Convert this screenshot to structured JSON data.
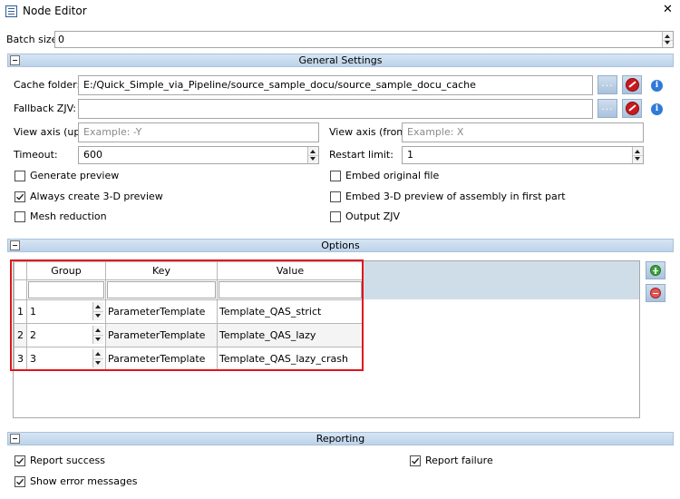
{
  "window": {
    "title": "Node Editor",
    "close_glyph": "✕"
  },
  "batch_size": {
    "label": "Batch size:",
    "value": "0"
  },
  "general": {
    "title": "General Settings",
    "cache_folder": {
      "label": "Cache folder:",
      "value": "E:/Quick_Simple_via_Pipeline/source_sample_docu/source_sample_docu_cache",
      "browse_label": "..."
    },
    "fallback_zjv": {
      "label": "Fallback ZJV:",
      "value": "",
      "browse_label": "..."
    },
    "view_axis_up": {
      "label": "View axis (up):",
      "placeholder": "Example: -Y"
    },
    "view_axis_front": {
      "label": "View axis (front):",
      "placeholder": "Example: X"
    },
    "timeout": {
      "label": "Timeout:",
      "value": "600"
    },
    "restart_limit": {
      "label": "Restart limit:",
      "value": "1"
    },
    "checkboxes": {
      "generate_preview": {
        "label": "Generate preview",
        "checked": false
      },
      "always_create_3d": {
        "label": "Always create 3-D preview",
        "checked": true
      },
      "mesh_reduction": {
        "label": "Mesh reduction",
        "checked": false
      },
      "embed_original": {
        "label": "Embed original file",
        "checked": false
      },
      "embed_3d_assembly": {
        "label": "Embed 3-D preview of assembly in first part",
        "checked": false
      },
      "output_zjv": {
        "label": "Output ZJV",
        "checked": false
      }
    }
  },
  "options": {
    "title": "Options",
    "columns": [
      "Group",
      "Key",
      "Value"
    ],
    "rows": [
      {
        "index": "1",
        "group": "1",
        "key": "ParameterTemplate",
        "value": "Template_QAS_strict"
      },
      {
        "index": "2",
        "group": "2",
        "key": "ParameterTemplate",
        "value": "Template_QAS_lazy"
      },
      {
        "index": "3",
        "group": "3",
        "key": "ParameterTemplate",
        "value": "Template_QAS_lazy_crash"
      }
    ]
  },
  "reporting": {
    "title": "Reporting",
    "report_success": {
      "label": "Report success",
      "checked": true
    },
    "report_failure": {
      "label": "Report failure",
      "checked": true
    },
    "show_errors": {
      "label": "Show error messages",
      "checked": true
    }
  },
  "colors": {
    "accent": "#bcd3ea",
    "highlight_border": "#e0141e",
    "remove_red": "#c8191e",
    "add_green": "#3ba33b"
  },
  "icons": [
    "window-icon",
    "close-icon",
    "collapse-icon",
    "browse-icon",
    "clear-icon",
    "info-icon",
    "add-icon",
    "remove-icon",
    "checkmark-icon"
  ]
}
